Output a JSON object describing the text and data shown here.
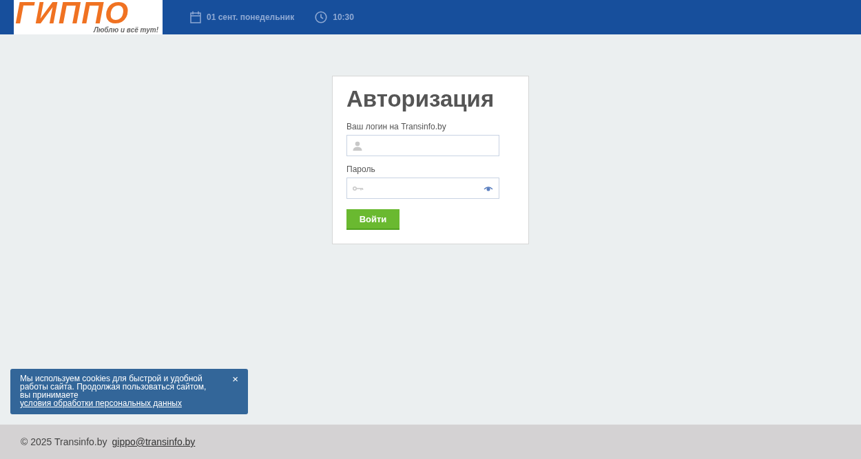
{
  "header": {
    "logo": {
      "wordmark": "ГИППО",
      "slogan": "Люблю и всё тут!"
    },
    "date": "01 сент. понедельник",
    "time": "10:30"
  },
  "login_form": {
    "title": "Авторизация",
    "fields": [
      {
        "kind": "login",
        "label": "Ваш логин на Transinfo.by"
      },
      {
        "kind": "password",
        "label": "Пароль"
      }
    ],
    "submit": "Войти"
  },
  "cookie_notice": {
    "text": "Мы используем cookies для быстрой и удобной работы сайта. Продолжая пользоваться сайтом, вы принимаете",
    "link": "условия обработки персональных данных",
    "close": "×"
  },
  "footer": {
    "copyright": "© 2025 Transinfo.by",
    "email": "gippo@transinfo.by"
  }
}
